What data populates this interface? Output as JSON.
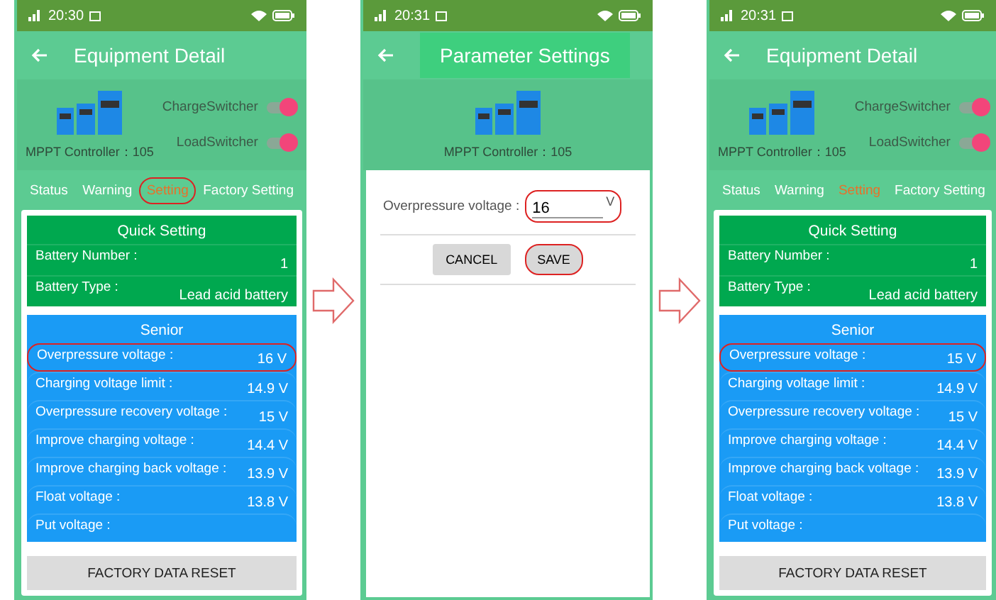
{
  "panels": [
    {
      "kind": "detail",
      "status_time": "20:30",
      "title": "Equipment Detail",
      "device_label": "MPPT Controller：105",
      "switches": [
        {
          "label": "ChargeSwitcher",
          "on": true
        },
        {
          "label": "LoadSwitcher",
          "on": true
        }
      ],
      "tabs": [
        {
          "label": "Status",
          "selected": false,
          "circled": false
        },
        {
          "label": "Warning",
          "selected": false,
          "circled": false
        },
        {
          "label": "Setting",
          "selected": true,
          "circled": true
        },
        {
          "label": "Factory Setting",
          "selected": false,
          "circled": false
        }
      ],
      "quick": {
        "title": "Quick Setting",
        "rows": [
          {
            "label": "Battery Number :",
            "value": "1"
          },
          {
            "label": "Battery Type :",
            "value": "Lead acid battery"
          }
        ]
      },
      "senior": {
        "title": "Senior",
        "rows": [
          {
            "label": "Overpressure voltage :",
            "value": "16 V",
            "circled": true
          },
          {
            "label": "Charging voltage limit :",
            "value": "14.9 V",
            "circled": false
          },
          {
            "label": "Overpressure recovery voltage :",
            "value": "15 V",
            "circled": false
          },
          {
            "label": "Improve charging voltage :",
            "value": "14.4 V",
            "circled": false
          },
          {
            "label": "Improve charging back voltage :",
            "value": "13.9 V",
            "circled": false
          },
          {
            "label": "Float voltage :",
            "value": "13.8 V",
            "circled": false
          },
          {
            "label": "Put voltage :",
            "circled": false
          }
        ]
      },
      "reset_button": "FACTORY DATA RESET"
    },
    {
      "kind": "param",
      "status_time": "20:31",
      "title": "Parameter Settings",
      "device_label": "MPPT Controller：105",
      "field": {
        "label": "Overpressure voltage :",
        "value": "16",
        "unit": "V",
        "circled": true
      },
      "buttons": [
        {
          "label": "CANCEL",
          "circled": false
        },
        {
          "label": "SAVE",
          "circled": true
        }
      ]
    },
    {
      "kind": "detail",
      "status_time": "20:31",
      "title": "Equipment Detail",
      "device_label": "MPPT Controller：105",
      "switches": [
        {
          "label": "ChargeSwitcher",
          "on": true
        },
        {
          "label": "LoadSwitcher",
          "on": true
        }
      ],
      "tabs": [
        {
          "label": "Status",
          "selected": false,
          "circled": false
        },
        {
          "label": "Warning",
          "selected": false,
          "circled": false
        },
        {
          "label": "Setting",
          "selected": true,
          "circled": false
        },
        {
          "label": "Factory Setting",
          "selected": false,
          "circled": false
        }
      ],
      "quick": {
        "title": "Quick Setting",
        "rows": [
          {
            "label": "Battery Number :",
            "value": "1"
          },
          {
            "label": "Battery Type :",
            "value": "Lead acid battery"
          }
        ]
      },
      "senior": {
        "title": "Senior",
        "rows": [
          {
            "label": "Overpressure voltage :",
            "value": "15 V",
            "circled": true
          },
          {
            "label": "Charging voltage limit :",
            "value": "14.9 V",
            "circled": false
          },
          {
            "label": "Overpressure recovery voltage :",
            "value": "15 V",
            "circled": false
          },
          {
            "label": "Improve charging voltage :",
            "value": "14.4 V",
            "circled": false
          },
          {
            "label": "Improve charging back voltage :",
            "value": "13.9 V",
            "circled": false
          },
          {
            "label": "Float voltage :",
            "value": "13.8 V",
            "circled": false
          },
          {
            "label": "Put voltage :",
            "circled": false
          }
        ]
      },
      "reset_button": "FACTORY DATA RESET"
    }
  ]
}
